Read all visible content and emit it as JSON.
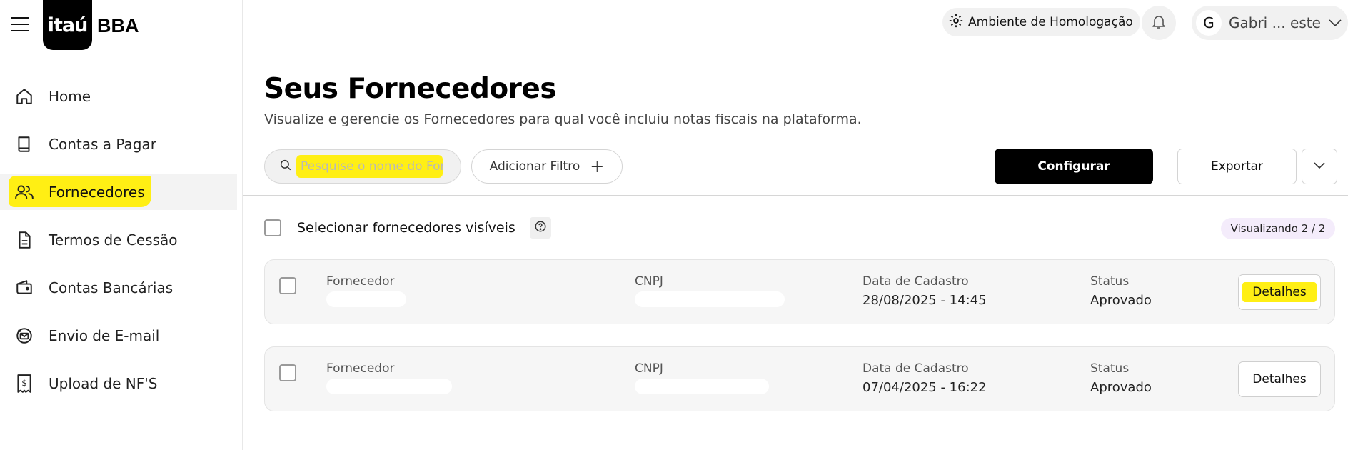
{
  "brand": {
    "logo_main": "itaú",
    "logo_suffix": "BBA"
  },
  "sidebar": {
    "items": [
      {
        "label": "Home",
        "icon": "home-icon"
      },
      {
        "label": "Contas a Pagar",
        "icon": "book-icon"
      },
      {
        "label": "Fornecedores",
        "icon": "users-icon",
        "active": true
      },
      {
        "label": "Termos de Cessão",
        "icon": "document-icon"
      },
      {
        "label": "Contas Bancárias",
        "icon": "wallet-icon"
      },
      {
        "label": "Envio de E-mail",
        "icon": "mail-icon"
      },
      {
        "label": "Upload de NF'S",
        "icon": "receipt-icon"
      }
    ]
  },
  "topbar": {
    "environment_label": "Ambiente de Homologação",
    "user_initial": "G",
    "user_name": "Gabri ... este"
  },
  "main": {
    "title": "Seus Fornecedores",
    "subtitle": "Visualize e gerencie os Fornecedores para qual você incluiu notas fiscais na plataforma.",
    "search_placeholder": "Pesquise o nome do For",
    "filter_label": "Adicionar Filtro",
    "configure_label": "Configurar",
    "export_label": "Exportar",
    "select_all_label": "Selecionar fornecedores visíveis",
    "badge": "Visualizando 2 / 2",
    "columns": {
      "supplier": "Fornecedor",
      "cnpj": "CNPJ",
      "date": "Data de Cadastro",
      "status": "Status"
    },
    "details_label": "Detalhes",
    "rows": [
      {
        "date": "28/08/2025 - 14:45",
        "status": "Aprovado"
      },
      {
        "date": "07/04/2025 - 16:22",
        "status": "Aprovado"
      }
    ]
  },
  "colors": {
    "highlight": "#ffef14",
    "primary": "#000000",
    "badge_bg": "#f4ecfb"
  }
}
